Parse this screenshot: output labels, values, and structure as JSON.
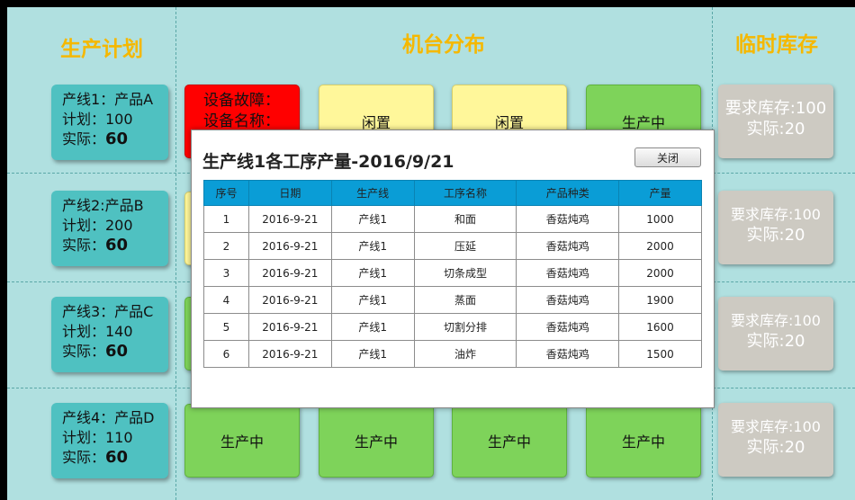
{
  "headings": {
    "plan": "生产计划",
    "machines": "机台分布",
    "stock": "临时库存"
  },
  "plans": [
    {
      "line": "产线1：产品A",
      "plan": "计划：100",
      "actual_label": "实际：",
      "actual": "60"
    },
    {
      "line": "产线2:产品B",
      "plan": "计划：200",
      "actual_label": "实际：",
      "actual": "60"
    },
    {
      "line": "产线3：产品C",
      "plan": "计划：140",
      "actual_label": "实际：",
      "actual": "60"
    },
    {
      "line": "产线4：产品D",
      "plan": "计划：110",
      "actual_label": "实际：",
      "actual": "60"
    }
  ],
  "machines_row1": {
    "fault_line1": "设备故障：",
    "fault_line2": "设备名称：",
    "m2": "闲置",
    "m3": "闲置",
    "m4": "生产中"
  },
  "machines_row4": {
    "m1": "生产中",
    "m2": "生产中",
    "m3": "生产中",
    "m4": "生产中"
  },
  "stock": [
    {
      "req": "要求库存:100",
      "actual": "实际:20"
    },
    {
      "req": "要求库存:100",
      "actual": "实际:20"
    },
    {
      "req": "要求库存:100",
      "actual": "实际:20"
    },
    {
      "req": "要求库存:100",
      "actual": "实际:20"
    }
  ],
  "modal": {
    "title": "生产线1各工序产量-2016/9/21",
    "close_label": "关闭",
    "columns": [
      "序号",
      "日期",
      "生产线",
      "工序名称",
      "产品种类",
      "产量"
    ],
    "rows": [
      [
        "1",
        "2016-9-21",
        "产线1",
        "和面",
        "香菇炖鸡",
        "1000"
      ],
      [
        "2",
        "2016-9-21",
        "产线1",
        "压延",
        "香菇炖鸡",
        "2000"
      ],
      [
        "3",
        "2016-9-21",
        "产线1",
        "切条成型",
        "香菇炖鸡",
        "2000"
      ],
      [
        "4",
        "2016-9-21",
        "产线1",
        "蒸面",
        "香菇炖鸡",
        "1900"
      ],
      [
        "5",
        "2016-9-21",
        "产线1",
        "切割分排",
        "香菇炖鸡",
        "1600"
      ],
      [
        "6",
        "2016-9-21",
        "产线1",
        "油炸",
        "香菇炖鸡",
        "1500"
      ]
    ]
  },
  "colors": {
    "background": "#b0e0e0",
    "heading": "#f5b800",
    "plan_card": "#4fc1c1",
    "idle": "#fff79a",
    "running": "#7ed35a",
    "fault": "#ff0000",
    "stock_card": "#cdcac2",
    "table_header": "#0a9dd6"
  }
}
